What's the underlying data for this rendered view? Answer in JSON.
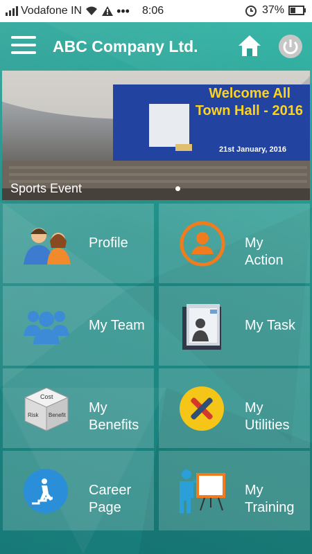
{
  "status_bar": {
    "carrier": "Vodafone IN",
    "time": "8:06",
    "battery": "37%"
  },
  "app_bar": {
    "title": "ABC Company Ltd."
  },
  "banner": {
    "headline_line1": "Welcome All",
    "headline_line2": "Town Hall - 2016",
    "date": "21st January, 2016",
    "caption": "Sports Event"
  },
  "tiles": [
    {
      "label_line1": "Profile",
      "label_line2": ""
    },
    {
      "label_line1": "My",
      "label_line2": "Action"
    },
    {
      "label_line1": "My Team",
      "label_line2": ""
    },
    {
      "label_line1": "My Task",
      "label_line2": ""
    },
    {
      "label_line1": "My",
      "label_line2": "Benefits"
    },
    {
      "label_line1": "My",
      "label_line2": "Utilities"
    },
    {
      "label_line1": "Career",
      "label_line2": "Page"
    },
    {
      "label_line1": "My",
      "label_line2": "Training"
    }
  ],
  "dice_words": {
    "top": "Cost",
    "left": "Risk",
    "right": "Benefit"
  },
  "colors": {
    "brand_teal": "#2a9f94",
    "banner_yellow": "#ffd31a",
    "action_orange": "#f07c1e",
    "team_blue": "#3d8ad6",
    "utilities_yellow": "#f5c518"
  }
}
